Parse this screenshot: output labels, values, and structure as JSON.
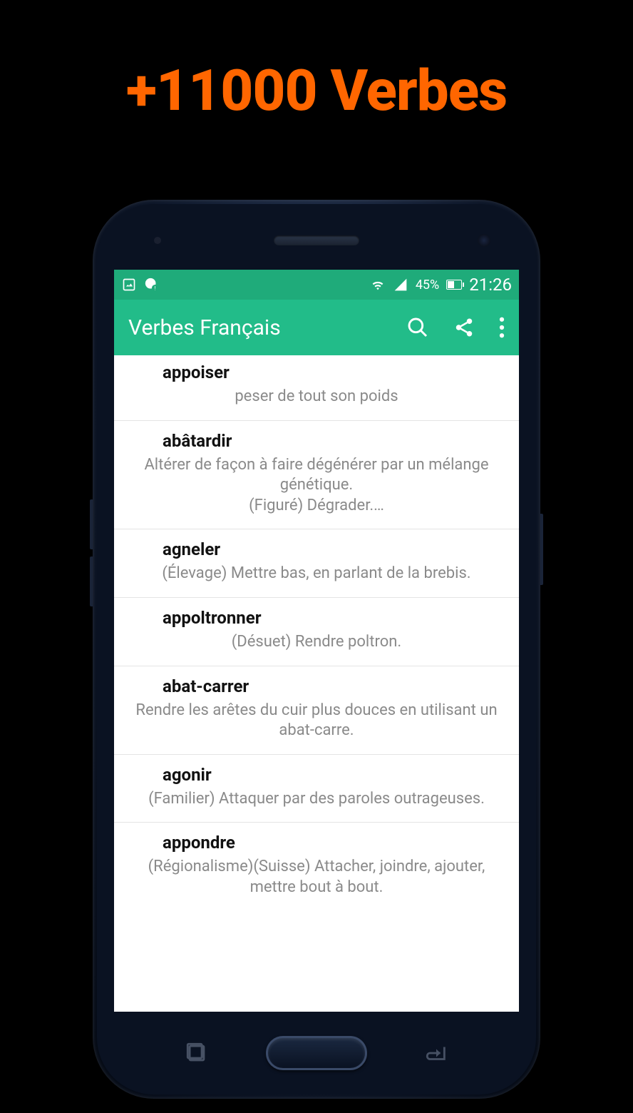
{
  "promo": {
    "title": "+11000 Verbes"
  },
  "statusbar": {
    "battery_pct": "45%",
    "time": "21:26"
  },
  "appbar": {
    "title": "Verbes Français"
  },
  "icons": {
    "search": "search-icon",
    "share": "share-icon",
    "overflow": "overflow-menu-icon"
  },
  "verbs": [
    {
      "word": "appoiser",
      "definition": "peser de tout son poids"
    },
    {
      "word": "abâtardir",
      "definition": "Altérer de façon à faire dégénérer par un mélange génétique.\n(Figuré) Dégrader.…"
    },
    {
      "word": "agneler",
      "definition": "(Élevage) Mettre bas, en parlant de la brebis."
    },
    {
      "word": "appoltronner",
      "definition": "(Désuet) Rendre poltron."
    },
    {
      "word": "abat-carrer",
      "definition": "Rendre les arêtes du cuir plus douces en utilisant un abat-carre."
    },
    {
      "word": "agonir",
      "definition": "(Familier) Attaquer par des paroles outrageuses."
    },
    {
      "word": "appondre",
      "definition": "(Régionalisme)(Suisse) Attacher, joindre, ajouter, mettre bout à bout."
    }
  ]
}
